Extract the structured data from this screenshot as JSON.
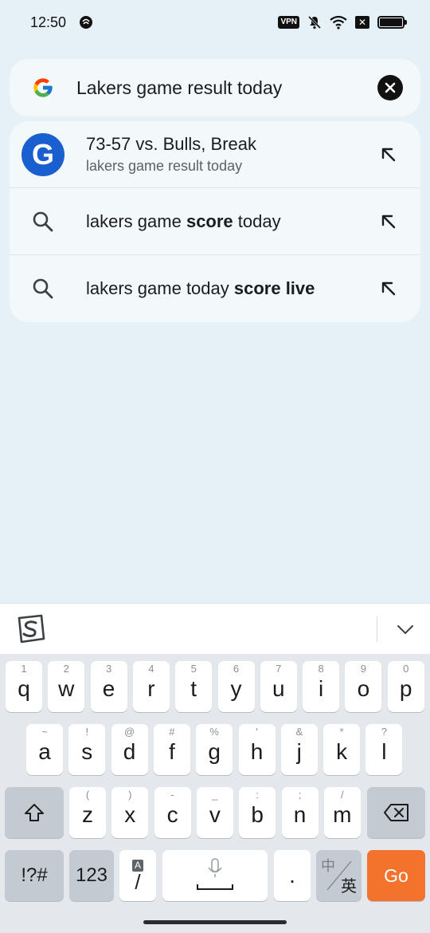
{
  "status_bar": {
    "time": "12:50",
    "vpn": "VPN",
    "icons": [
      "app-notification-icon",
      "vpn-icon",
      "muted-bell-icon",
      "wifi-icon",
      "no-sim-icon",
      "battery-icon"
    ],
    "battery_level": 1.0
  },
  "search": {
    "query": "Lakers game result today",
    "leading_icon": "google-g-icon",
    "clear_icon": "clear-icon"
  },
  "suggestions": [
    {
      "type": "rich",
      "icon": "google-circle-icon",
      "icon_letter": "G",
      "title": "73-57 vs. Bulls, Break",
      "subtitle": "lakers game result today"
    },
    {
      "type": "query",
      "icon": "search-icon",
      "text_normal": "lakers game ",
      "text_bold": "score",
      "text_after": " today"
    },
    {
      "type": "query",
      "icon": "search-icon",
      "text_normal": "lakers game today ",
      "text_bold": "score live",
      "text_after": ""
    }
  ],
  "keyboard": {
    "toolbar_logo": "sogou-logo-icon",
    "collapse_icon": "chevron-down-icon",
    "row1": [
      {
        "k": "q",
        "h": "1"
      },
      {
        "k": "w",
        "h": "2"
      },
      {
        "k": "e",
        "h": "3"
      },
      {
        "k": "r",
        "h": "4"
      },
      {
        "k": "t",
        "h": "5"
      },
      {
        "k": "y",
        "h": "6"
      },
      {
        "k": "u",
        "h": "7"
      },
      {
        "k": "i",
        "h": "8"
      },
      {
        "k": "o",
        "h": "9"
      },
      {
        "k": "p",
        "h": "0"
      }
    ],
    "row2": [
      {
        "k": "a",
        "h": "~"
      },
      {
        "k": "s",
        "h": "!"
      },
      {
        "k": "d",
        "h": "@"
      },
      {
        "k": "f",
        "h": "#"
      },
      {
        "k": "g",
        "h": "%"
      },
      {
        "k": "h",
        "h": "'"
      },
      {
        "k": "j",
        "h": "&"
      },
      {
        "k": "k",
        "h": "*"
      },
      {
        "k": "l",
        "h": "?"
      }
    ],
    "row3": [
      {
        "k": "z",
        "h": "("
      },
      {
        "k": "x",
        "h": ")"
      },
      {
        "k": "c",
        "h": "-"
      },
      {
        "k": "v",
        "h": "_"
      },
      {
        "k": "b",
        "h": ":"
      },
      {
        "k": "n",
        "h": ";"
      },
      {
        "k": "m",
        "h": "/"
      }
    ],
    "symbols_label": "!?#",
    "numbers_label": "123",
    "slash_hint": "A",
    "slash_label": "/",
    "period_label": ".",
    "lang_top": "中",
    "lang_bottom": "英",
    "go_label": "Go",
    "go_color": "#f3732d"
  }
}
